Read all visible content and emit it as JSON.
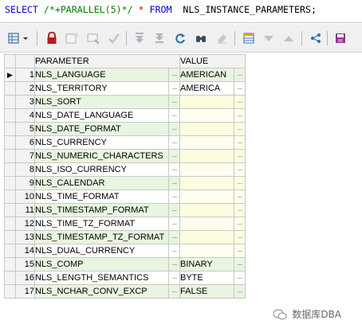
{
  "sql": {
    "select_kw": "SELECT",
    "hint": "/*+PARALLEL(5)*/",
    "star": "*",
    "from_kw": "FROM",
    "table": "NLS_INSTANCE_PARAMETERS;"
  },
  "grid": {
    "columns": [
      "PARAMETER",
      "VALUE"
    ],
    "current_row_indicator": "▶",
    "cell_button": "···",
    "rows": [
      {
        "num": "1",
        "parameter": "NLS_LANGUAGE",
        "value": "AMERICAN"
      },
      {
        "num": "2",
        "parameter": "NLS_TERRITORY",
        "value": "AMERICA"
      },
      {
        "num": "3",
        "parameter": "NLS_SORT",
        "value": ""
      },
      {
        "num": "4",
        "parameter": "NLS_DATE_LANGUAGE",
        "value": ""
      },
      {
        "num": "5",
        "parameter": "NLS_DATE_FORMAT",
        "value": ""
      },
      {
        "num": "6",
        "parameter": "NLS_CURRENCY",
        "value": ""
      },
      {
        "num": "7",
        "parameter": "NLS_NUMERIC_CHARACTERS",
        "value": ""
      },
      {
        "num": "8",
        "parameter": "NLS_ISO_CURRENCY",
        "value": ""
      },
      {
        "num": "9",
        "parameter": "NLS_CALENDAR",
        "value": ""
      },
      {
        "num": "10",
        "parameter": "NLS_TIME_FORMAT",
        "value": ""
      },
      {
        "num": "11",
        "parameter": "NLS_TIMESTAMP_FORMAT",
        "value": ""
      },
      {
        "num": "12",
        "parameter": "NLS_TIME_TZ_FORMAT",
        "value": ""
      },
      {
        "num": "13",
        "parameter": "NLS_TIMESTAMP_TZ_FORMAT",
        "value": ""
      },
      {
        "num": "14",
        "parameter": "NLS_DUAL_CURRENCY",
        "value": ""
      },
      {
        "num": "15",
        "parameter": "NLS_COMP",
        "value": "BINARY"
      },
      {
        "num": "16",
        "parameter": "NLS_LENGTH_SEMANTICS",
        "value": "BYTE"
      },
      {
        "num": "17",
        "parameter": "NLS_NCHAR_CONV_EXCP",
        "value": "FALSE"
      }
    ]
  },
  "watermark": {
    "text": "数据库DBA"
  },
  "icons": {
    "grid_options": "grid-options-icon",
    "lock": "lock-icon",
    "insert_record": "insert-record-icon",
    "delete_record": "delete-record-icon",
    "post_edit": "post-edit-icon",
    "first": "first-record-icon",
    "last": "last-record-icon",
    "refresh": "refresh-icon",
    "find": "find-icon",
    "clear": "clear-icon",
    "query_by_example": "query-by-example-icon",
    "sort_desc": "sort-descending-icon",
    "sort_asc": "sort-ascending-icon",
    "export": "export-icon",
    "save": "save-icon"
  },
  "colors": {
    "row_stripe": "#e8f5e0",
    "null_cell": "#fffde0",
    "keyword": "#0000c8",
    "hint": "#008000"
  }
}
